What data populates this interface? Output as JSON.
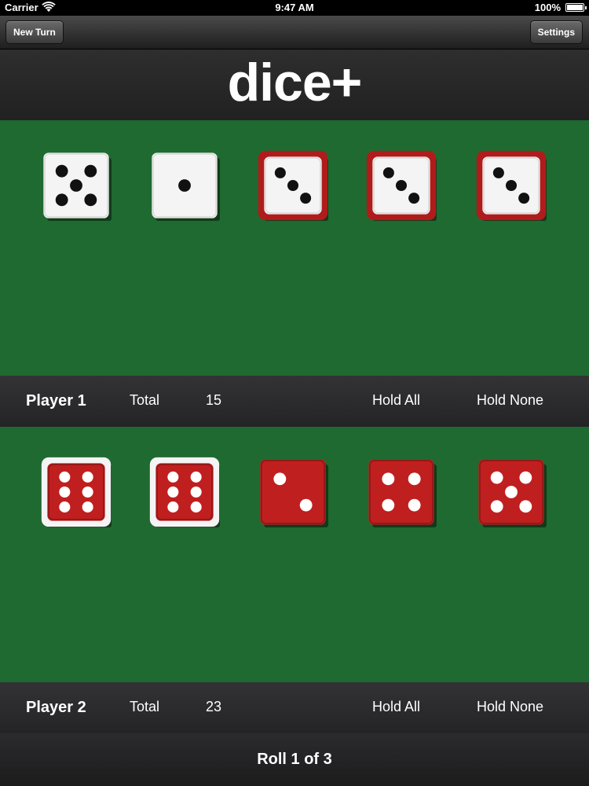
{
  "status_bar": {
    "carrier": "Carrier",
    "time": "9:47 AM",
    "battery": "100%"
  },
  "nav": {
    "new_turn_label": "New Turn",
    "settings_label": "Settings"
  },
  "logo": "dice+",
  "colors": {
    "felt": "#1f6a30",
    "white_die": "#f4f4f4",
    "red_die": "#c01f1f",
    "held_border_red": "#b01c1c",
    "held_border_white": "#f4f4f4"
  },
  "players": [
    {
      "name": "Player 1",
      "total_label": "Total",
      "total": "15",
      "hold_all_label": "Hold All",
      "hold_none_label": "Hold None",
      "dice": [
        {
          "value": 5,
          "color": "white",
          "held": false
        },
        {
          "value": 1,
          "color": "white",
          "held": false
        },
        {
          "value": 3,
          "color": "white",
          "held": true
        },
        {
          "value": 3,
          "color": "white",
          "held": true
        },
        {
          "value": 3,
          "color": "white",
          "held": true
        }
      ]
    },
    {
      "name": "Player 2",
      "total_label": "Total",
      "total": "23",
      "hold_all_label": "Hold All",
      "hold_none_label": "Hold None",
      "dice": [
        {
          "value": 6,
          "color": "red",
          "held": true
        },
        {
          "value": 6,
          "color": "red",
          "held": true
        },
        {
          "value": 2,
          "color": "red",
          "held": false
        },
        {
          "value": 4,
          "color": "red",
          "held": false
        },
        {
          "value": 5,
          "color": "red",
          "held": false
        }
      ]
    }
  ],
  "roll_status": "Roll 1 of 3"
}
